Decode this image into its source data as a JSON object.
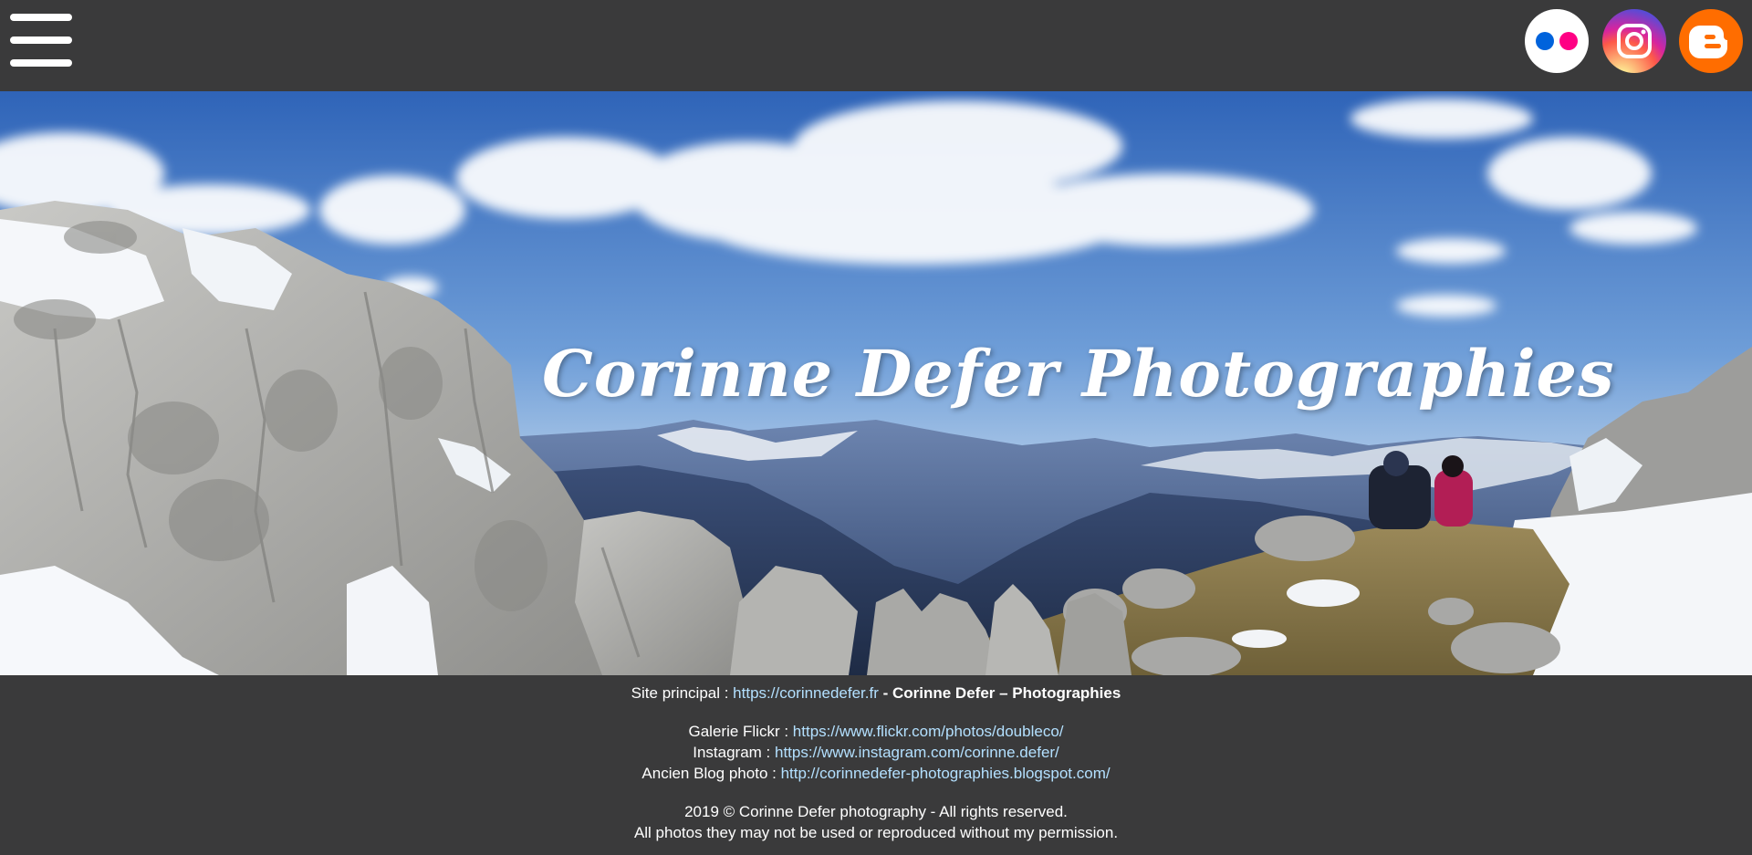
{
  "header": {
    "menu_icon": "hamburger-menu-icon",
    "social": [
      {
        "name": "flickr",
        "icon": "flickr-icon"
      },
      {
        "name": "instagram",
        "icon": "instagram-icon"
      },
      {
        "name": "blogger",
        "icon": "blogger-icon"
      }
    ]
  },
  "hero": {
    "title": "Corinne Defer Photographies",
    "image": "mountain-panorama-photo"
  },
  "footer": {
    "site_label": "Site principal : ",
    "site_url": "https://corinnedefer.fr",
    "site_sep": " - ",
    "site_name": "Corinne Defer – Photographies",
    "flickr_label": "Galerie Flickr : ",
    "flickr_url": "https://www.flickr.com/photos/doubleco/",
    "instagram_label": "Instagram : ",
    "instagram_url": "https://www.instagram.com/corinne.defer/",
    "blog_label": "Ancien Blog photo : ",
    "blog_url": "http://corinnedefer-photographies.blogspot.com/",
    "copyright": "2019 © Corinne Defer photography - All rights reserved.",
    "notice": "All photos they may not be used or reproduced without my permission."
  },
  "colors": {
    "background": "#3a3a3b",
    "link": "#b3e0ff",
    "flickr_blue": "#0063dc",
    "flickr_pink": "#ff0084",
    "blogger_orange": "#ff6d00"
  }
}
